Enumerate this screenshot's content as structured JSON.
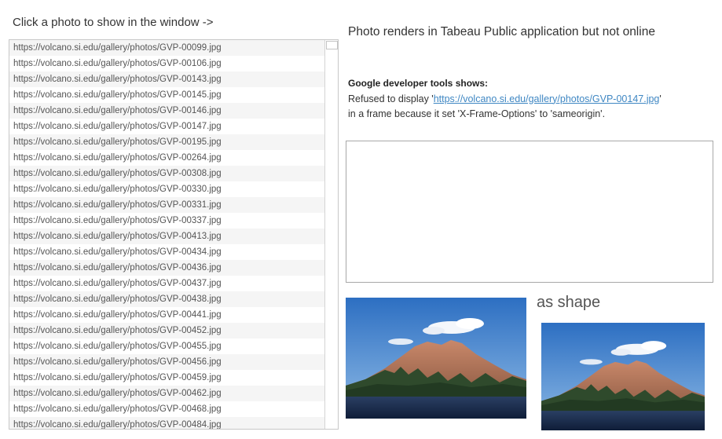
{
  "left_panel": {
    "title": "Click a photo to show in the window ->",
    "urls": [
      "https://volcano.si.edu/gallery/photos/GVP-00099.jpg",
      "https://volcano.si.edu/gallery/photos/GVP-00106.jpg",
      "https://volcano.si.edu/gallery/photos/GVP-00143.jpg",
      "https://volcano.si.edu/gallery/photos/GVP-00145.jpg",
      "https://volcano.si.edu/gallery/photos/GVP-00146.jpg",
      "https://volcano.si.edu/gallery/photos/GVP-00147.jpg",
      "https://volcano.si.edu/gallery/photos/GVP-00195.jpg",
      "https://volcano.si.edu/gallery/photos/GVP-00264.jpg",
      "https://volcano.si.edu/gallery/photos/GVP-00308.jpg",
      "https://volcano.si.edu/gallery/photos/GVP-00330.jpg",
      "https://volcano.si.edu/gallery/photos/GVP-00331.jpg",
      "https://volcano.si.edu/gallery/photos/GVP-00337.jpg",
      "https://volcano.si.edu/gallery/photos/GVP-00413.jpg",
      "https://volcano.si.edu/gallery/photos/GVP-00434.jpg",
      "https://volcano.si.edu/gallery/photos/GVP-00436.jpg",
      "https://volcano.si.edu/gallery/photos/GVP-00437.jpg",
      "https://volcano.si.edu/gallery/photos/GVP-00438.jpg",
      "https://volcano.si.edu/gallery/photos/GVP-00441.jpg",
      "https://volcano.si.edu/gallery/photos/GVP-00452.jpg",
      "https://volcano.si.edu/gallery/photos/GVP-00455.jpg",
      "https://volcano.si.edu/gallery/photos/GVP-00456.jpg",
      "https://volcano.si.edu/gallery/photos/GVP-00459.jpg",
      "https://volcano.si.edu/gallery/photos/GVP-00462.jpg",
      "https://volcano.si.edu/gallery/photos/GVP-00468.jpg",
      "https://volcano.si.edu/gallery/photos/GVP-00484.jpg"
    ]
  },
  "right_panel": {
    "title": "Photo renders in Tabeau Public application but not online",
    "devtools_heading": "Google developer tools shows:",
    "devtools_prefix": "Refused to display '",
    "devtools_link": "https://volcano.si.edu/gallery/photos/GVP-00147.jpg",
    "devtools_mid": "'",
    "devtools_suffix": "in a frame because it set 'X-Frame-Options' to 'sameorigin'.",
    "shape_label": "as shape"
  },
  "colors": {
    "link": "#3f87c3",
    "row_stripe": "#f5f5f5",
    "border": "#c8c8c8"
  }
}
